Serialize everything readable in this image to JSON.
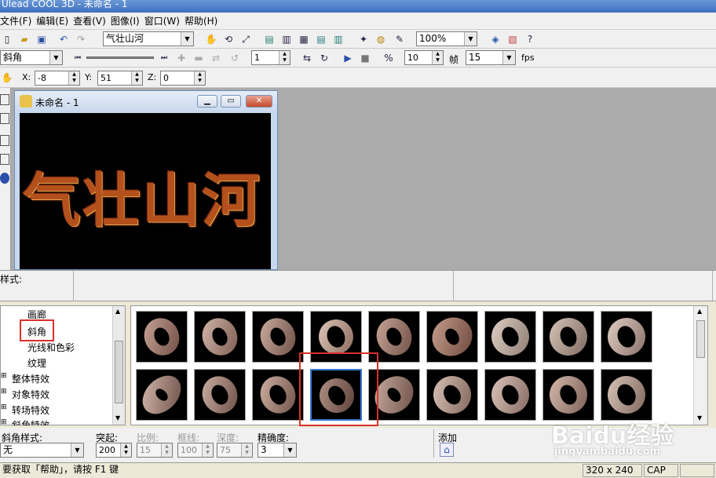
{
  "window": {
    "title": "Ulead COOL 3D - 未命名 - 1"
  },
  "menu": [
    "文件(F)",
    "编辑(E)",
    "查看(V)",
    "图像(I)",
    "窗口(W)",
    "帮助(H)"
  ],
  "toolbar1": {
    "object_combo": "气壮山河",
    "zoom_combo": "100%"
  },
  "toolbar2": {
    "effect_combo": "斜角",
    "frame_spin": "1",
    "frames_spin": "10",
    "frames_label": "帧",
    "fps_spin": "15",
    "fps_label": "fps"
  },
  "toolbar3": {
    "x_label": "X:",
    "x_value": "-8",
    "y_label": "Y:",
    "y_value": "51",
    "z_label": "Z:",
    "z_value": "0"
  },
  "document": {
    "title": "未命名 - 1",
    "canvas_text": "气壮山河"
  },
  "style_label": "样式:",
  "tree": {
    "items": [
      "画廊",
      "斜角",
      "光线和色彩",
      "纹理",
      "整体特效",
      "对象特效",
      "转场特效",
      "斜角特效"
    ],
    "selected": "斜角"
  },
  "params": {
    "bevel_style_label": "斜角样式:",
    "bevel_style_value": "无",
    "protrude_label": "突起:",
    "protrude_value": "200",
    "ratio_label": "比例:",
    "ratio_value": "15",
    "border_label": "框线:",
    "border_value": "100",
    "depth_label": "深度:",
    "depth_value": "75",
    "precision_label": "精确度:",
    "precision_value": "3",
    "add_label": "添加"
  },
  "status": {
    "help_text": "要获取「帮助」，请按 F1 键",
    "size": "320 x 240",
    "caps": "CAP"
  },
  "watermark": {
    "brand": "Baidu经验",
    "url": "jingyan.baidu.com"
  },
  "colors": {
    "selection": "#3a78d8",
    "highlight_box": "#d9302a"
  }
}
